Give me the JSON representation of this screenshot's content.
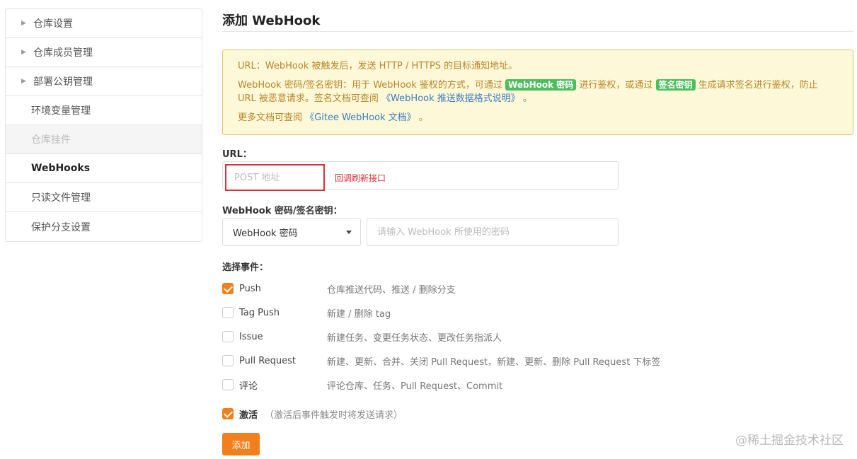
{
  "sidebar": {
    "items": [
      {
        "label": "仓库设置",
        "caret": true,
        "state": "normal"
      },
      {
        "label": "仓库成员管理",
        "caret": true,
        "state": "normal"
      },
      {
        "label": "部署公钥管理",
        "caret": true,
        "state": "normal"
      },
      {
        "label": "环境变量管理",
        "caret": false,
        "state": "normal"
      },
      {
        "label": "仓库挂件",
        "caret": false,
        "state": "disabled"
      },
      {
        "label": "WebHooks",
        "caret": false,
        "state": "active"
      },
      {
        "label": "只读文件管理",
        "caret": false,
        "state": "normal"
      },
      {
        "label": "保护分支设置",
        "caret": false,
        "state": "normal"
      }
    ]
  },
  "main": {
    "title": "添加 WebHook",
    "notice": {
      "line1": "URL：WebHook 被触发后，发送 HTTP / HTTPS 的目标通知地址。",
      "line2_pre": "WebHook 密码/签名密钥：用于 WebHook 鉴权的方式，可通过",
      "tag_password": "WebHook 密码",
      "line2_mid": "进行鉴权，或通过",
      "tag_signature": "签名密钥",
      "line2_post": "生成请求签名进行鉴权，防止 URL 被恶意请求。签名文档可查阅",
      "link_format": "《WebHook 推送数据格式说明》",
      "line2_end": "。",
      "line3_pre": "更多文档可查阅",
      "link_docs": "《Gitee WebHook 文档》",
      "line3_end": "。"
    },
    "url": {
      "label": "URL：",
      "placeholder": "POST 地址",
      "value": "",
      "hint": "回调刷新接口"
    },
    "secret": {
      "label": "WebHook 密码/签名密钥：",
      "select_value": "WebHook 密码",
      "placeholder": "请输入 WebHook 所使用的密码"
    },
    "events": {
      "label": "选择事件：",
      "items": [
        {
          "name": "Push",
          "desc": "仓库推送代码、推送 / 删除分支",
          "checked": true
        },
        {
          "name": "Tag Push",
          "desc": "新建 / 删除 tag",
          "checked": false
        },
        {
          "name": "Issue",
          "desc": "新建任务、变更任务状态、更改任务指派人",
          "checked": false
        },
        {
          "name": "Pull Request",
          "desc": "新建、更新、合并、关闭 Pull Request，新建、更新、删除 Pull Request 下标签",
          "checked": false
        },
        {
          "name": "评论",
          "desc": "评论仓库、任务、Pull Request、Commit",
          "checked": false
        }
      ]
    },
    "activate": {
      "label": "激活",
      "hint": "（激活后事件触发时将发送请求）",
      "checked": true
    },
    "add_button": "添加"
  },
  "watermark": "@稀土掘金技术社区",
  "colors": {
    "accent": "#f17f1b",
    "notice_bg": "#fdf8d8",
    "notice_border": "#e4c36b",
    "tag_green": "#4bbf5d",
    "error_red": "#d9303b",
    "link_blue": "#3c7dbf"
  }
}
